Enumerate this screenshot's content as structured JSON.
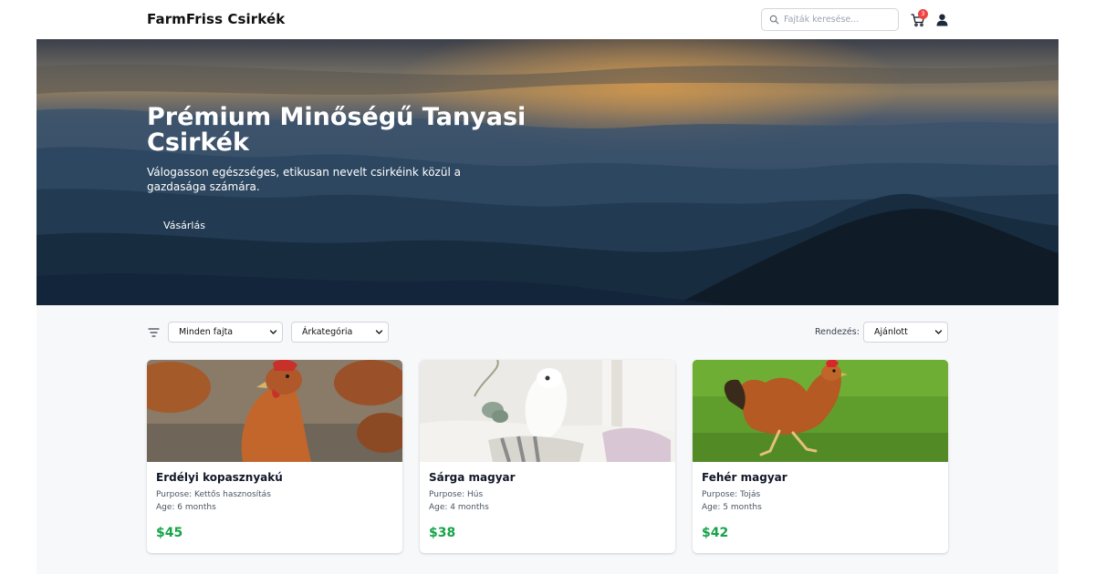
{
  "header": {
    "brand": "FarmFriss Csirkék",
    "search_placeholder": "Fajták keresése...",
    "cart_count": "3",
    "icons": {
      "search": "search-icon",
      "cart": "cart-icon",
      "user": "user-icon"
    }
  },
  "hero": {
    "title": "Prémium Minőségű Tanyasi Csirkék",
    "subtitle": "Válogasson egészséges, etikusan nevelt csirkéink közül a gazdasága számára.",
    "button": "Vásárlás"
  },
  "filters": {
    "breed_select": "Minden fajta",
    "price_select": "Árkategória",
    "sort_label": "Rendezés:",
    "sort_select": "Ajánlott"
  },
  "products": [
    {
      "name": "Erdélyi kopasznyakú",
      "purpose": "Purpose: Kettős hasznosítás",
      "age": "Age: 6 months",
      "price": "$45"
    },
    {
      "name": "Sárga magyar",
      "purpose": "Purpose: Hús",
      "age": "Age: 4 months",
      "price": "$38"
    },
    {
      "name": "Fehér magyar",
      "purpose": "Purpose: Tojás",
      "age": "Age: 5 months",
      "price": "$42"
    }
  ],
  "colors": {
    "accent_price": "#16a34a",
    "badge": "#ef4444",
    "content_bg": "#f7f8fa"
  }
}
